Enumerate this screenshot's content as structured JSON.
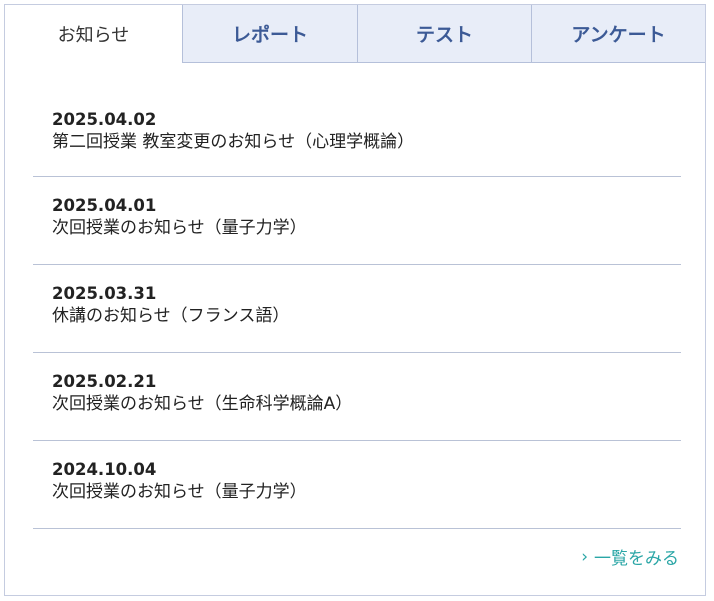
{
  "tabs": [
    {
      "label": "お知らせ",
      "active": true
    },
    {
      "label": "レポート",
      "active": false
    },
    {
      "label": "テスト",
      "active": false
    },
    {
      "label": "アンケート",
      "active": false
    }
  ],
  "notices": [
    {
      "date": "2025.04.02",
      "title": "第二回授業 教室変更のお知らせ（心理学概論）"
    },
    {
      "date": "2025.04.01",
      "title": "次回授業のお知らせ（量子力学）"
    },
    {
      "date": "2025.03.31",
      "title": "休講のお知らせ（フランス語）"
    },
    {
      "date": "2025.02.21",
      "title": "次回授業のお知らせ（生命科学概論A）"
    },
    {
      "date": "2024.10.04",
      "title": "次回授業のお知らせ（量子力学）"
    }
  ],
  "more": {
    "label": "一覧をみる",
    "icon": "chevron-right-icon"
  },
  "colors": {
    "tab_inactive_bg": "#e8edf8",
    "tab_inactive_text": "#3c5a96",
    "link": "#2aa6a6",
    "divider": "#b9c2d6"
  }
}
